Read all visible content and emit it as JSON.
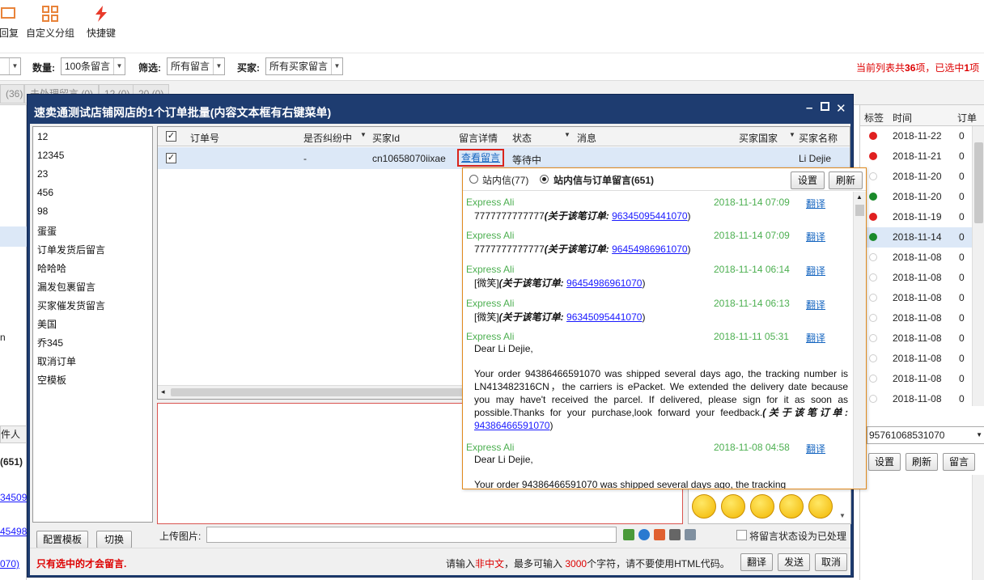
{
  "toolbar": {
    "items": [
      {
        "label": "回复",
        "icon": "reply-icon"
      },
      {
        "label": "自定义分组",
        "icon": "grid-icon"
      },
      {
        "label": "快捷键",
        "icon": "lightning-icon"
      }
    ]
  },
  "filters": {
    "count_label": "数量:",
    "count_value": "100条留言",
    "filter_label": "筛选:",
    "filter_value": "所有留言",
    "buyer_label": "买家:",
    "buyer_value": "所有买家留言",
    "status_prefix": "当前列表共",
    "status_total": "36",
    "status_mid": "项，已选中",
    "status_selected": "1",
    "status_suffix": "项"
  },
  "bg_tabs": {
    "first": "(36)",
    "second": "未处理留言 (0)",
    "third": "12 (0)",
    "fourth": "20 (0)"
  },
  "bg_table": {
    "headers": {
      "tag": "标签",
      "time": "时间",
      "extra": "订单"
    },
    "rows": [
      {
        "dot": "#e02020",
        "time": "2018-11-22",
        "v": "0"
      },
      {
        "dot": "#e02020",
        "time": "2018-11-21",
        "v": "0"
      },
      {
        "dot": "none",
        "time": "2018-11-20",
        "v": "0"
      },
      {
        "dot": "#1a8a2a",
        "time": "2018-11-20",
        "v": "0"
      },
      {
        "dot": "#e02020",
        "time": "2018-11-19",
        "v": "0"
      },
      {
        "dot": "#1a8a2a",
        "time": "2018-11-14",
        "v": "0"
      },
      {
        "dot": "none",
        "time": "2018-11-08",
        "v": "0"
      },
      {
        "dot": "none",
        "time": "2018-11-08",
        "v": "0"
      },
      {
        "dot": "none",
        "time": "2018-11-08",
        "v": "0"
      },
      {
        "dot": "none",
        "time": "2018-11-08",
        "v": "0"
      },
      {
        "dot": "none",
        "time": "2018-11-08",
        "v": "0"
      },
      {
        "dot": "none",
        "time": "2018-11-08",
        "v": "0"
      },
      {
        "dot": "none",
        "time": "2018-11-08",
        "v": "0"
      },
      {
        "dot": "none",
        "time": "2018-11-08",
        "v": "0"
      }
    ],
    "order_field": "95761068531070",
    "btn_settings": "设置",
    "btn_refresh": "刷新",
    "btn_message": "留言"
  },
  "left_strip": {
    "letter": "n",
    "label1": "件人",
    "label2": "(651)",
    "link1": "34509",
    "link2": "45498",
    "link3": "070)"
  },
  "dialog": {
    "title": "速卖通测试店铺网店的1个订单批量(内容文本框有右键菜单)",
    "templates": [
      "12",
      "12345",
      "23",
      "456",
      "98",
      "蛋蛋",
      "订单发货后留言",
      "哈哈哈",
      "漏发包裹留言",
      "买家催发货留言",
      "美国",
      "乔345",
      "取消订单",
      "空模板"
    ],
    "btn_config": "配置模板",
    "btn_switch": "切换",
    "columns": {
      "order_no": "订单号",
      "dispute": "是否纠纷中",
      "buyer_id": "买家Id",
      "detail": "留言详情",
      "status": "状态",
      "message": "消息",
      "country": "买家国家",
      "buyer_name": "买家名称"
    },
    "row": {
      "dispute": "-",
      "buyer_id": "cn10658070iixae",
      "detail": "查看留言",
      "status": "等待中",
      "buyer_name": "Li Dejie"
    },
    "upload_label": "上传图片:",
    "mark_processed": "将留言状态设为已处理",
    "foot_warning": "只有选中的才会留言.",
    "foot_hint_1": "请输入",
    "foot_hint_2": "非中文",
    "foot_hint_3": "，最多可输入 ",
    "foot_hint_4": "3000",
    "foot_hint_5": "个字符，请不要使用HTML代码。",
    "btn_translate": "翻译",
    "btn_send": "发送",
    "btn_cancel": "取消"
  },
  "popup": {
    "radio1": "站内信(77)",
    "radio2": "站内信与订单留言(651)",
    "btn_settings": "设置",
    "btn_refresh": "刷新",
    "order_ref_label": "(关于该笔订单:",
    "messages": [
      {
        "sender": "Express Ali",
        "time": "2018-11-14 07:09",
        "translate": "翻译",
        "text": "7777777777777",
        "order": "96345095441070"
      },
      {
        "sender": "Express Ali",
        "time": "2018-11-14 07:09",
        "translate": "翻译",
        "text": "7777777777777",
        "order": "96454986961070"
      },
      {
        "sender": "Express Ali",
        "time": "2018-11-14 06:14",
        "translate": "翻译",
        "text": "[微笑]",
        "order": "96454986961070"
      },
      {
        "sender": "Express Ali",
        "time": "2018-11-14 06:13",
        "translate": "翻译",
        "text": "[微笑]",
        "order": "96345095441070"
      },
      {
        "sender": "Express Ali",
        "time": "2018-11-11 05:31",
        "translate": "翻译",
        "greeting": "Dear Li Dejie,",
        "text": "Your order 94386466591070 was shipped several days ago, the tracking number is LN413482316CN，the carriers is ePacket. We extended the delivery date because you may have't received the parcel. If delivered, please sign for it as soon as possible.Thanks for your purchase,look forward your feedback.",
        "order": "94386466591070"
      },
      {
        "sender": "Express Ali",
        "time": "2018-11-08 04:58",
        "translate": "翻译",
        "greeting": "Dear Li Dejie,",
        "text": "Your order 94386466591070 was shipped several days ago, the tracking"
      }
    ]
  }
}
